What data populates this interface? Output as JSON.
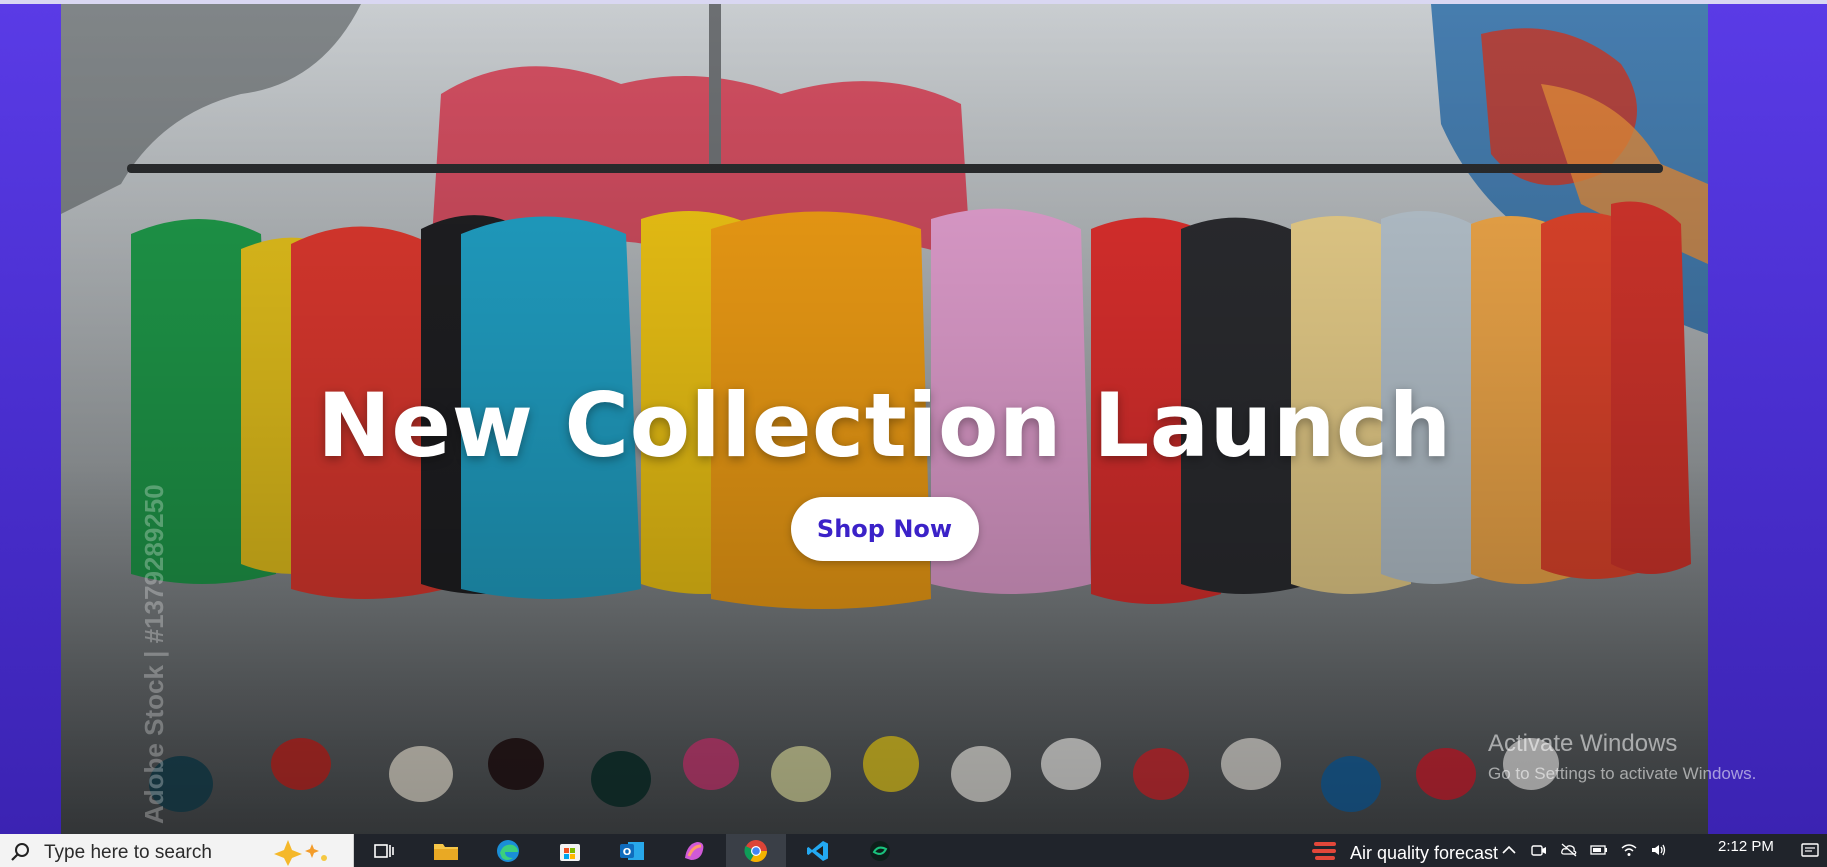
{
  "hero": {
    "title": "New Collection Launch",
    "cta_label": "Shop Now",
    "stock_watermark": "Adobe Stock | #1379289250"
  },
  "activation": {
    "heading": "Activate Windows",
    "subtext": "Go to Settings to activate Windows."
  },
  "taskbar": {
    "search_placeholder": "Type here to search",
    "weather_label": "Air quality forecast",
    "time": "2:12 PM",
    "apps": [
      "task-view",
      "file-explorer",
      "edge",
      "microsoft-store",
      "outlook",
      "copilot",
      "chrome",
      "vscode",
      "chatgpt"
    ]
  },
  "colors": {
    "page_gradient_top": "#5a3be6",
    "page_gradient_bottom": "#3a22b0",
    "cta_text": "#3b22c8",
    "cta_bg": "#ffffff",
    "taskbar": "#20242b"
  }
}
